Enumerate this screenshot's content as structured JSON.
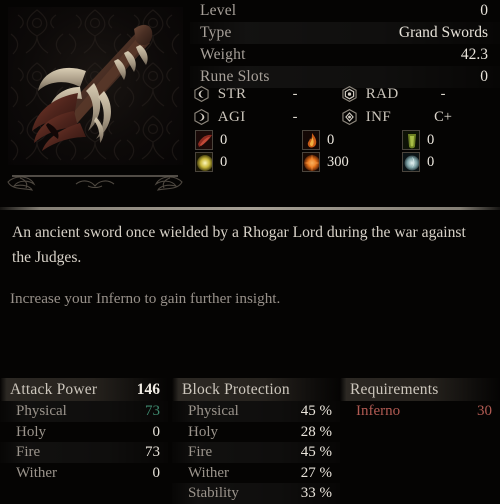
{
  "item": {
    "portrait_name": "weapon-portrait",
    "info_rows": [
      {
        "label": "Level",
        "value": "0"
      },
      {
        "label": "Type",
        "value": "Grand Swords"
      },
      {
        "label": "Weight",
        "value": "42.3"
      },
      {
        "label": "Rune Slots",
        "value": "0"
      }
    ],
    "scaling": [
      {
        "icon": "strength-icon",
        "stat": "STR",
        "grade": "-",
        "icon2": "radiance-icon",
        "stat2": "RAD",
        "grade2": "-"
      },
      {
        "icon": "agility-icon",
        "stat": "AGI",
        "grade": "-",
        "icon2": "inferno-icon",
        "stat2": "INF",
        "grade2": "C+"
      }
    ],
    "damage": [
      {
        "icon": "physical-damage-icon",
        "value": "0",
        "icon_b": "fire-damage-icon",
        "value_b": "0",
        "icon_c": "poison-damage-icon",
        "value_c": "0"
      },
      {
        "icon": "holy-damage-icon",
        "value": "0",
        "icon_b": "burn-damage-icon",
        "value_b": "300",
        "icon_c": "frost-damage-icon",
        "value_c": "0"
      }
    ],
    "description": "An ancient sword once wielded by a Rhogar Lord during the war against the Judges.",
    "hint": "Increase your Inferno to gain further insight."
  },
  "panels": {
    "attack_power": {
      "title": "Attack Power",
      "total": "146",
      "rows": [
        {
          "label": "Physical",
          "value": "73",
          "color": "green"
        },
        {
          "label": "Holy",
          "value": "0",
          "color": ""
        },
        {
          "label": "Fire",
          "value": "73",
          "color": ""
        },
        {
          "label": "Wither",
          "value": "0",
          "color": ""
        }
      ]
    },
    "block_protection": {
      "title": "Block Protection",
      "total": "",
      "rows": [
        {
          "label": "Physical",
          "value": "45 %"
        },
        {
          "label": "Holy",
          "value": "28 %"
        },
        {
          "label": "Fire",
          "value": "45 %"
        },
        {
          "label": "Wither",
          "value": "27 %"
        },
        {
          "label": "Stability",
          "value": "33 %"
        }
      ]
    },
    "requirements": {
      "title": "Requirements",
      "total": "",
      "rows": [
        {
          "label": "Inferno",
          "value": "30",
          "color": "red"
        }
      ]
    }
  },
  "colors": {
    "background": "#050403",
    "text_primary": "#e8e3da",
    "text_muted": "#9b948c",
    "green_value": "#3f8a6f",
    "red_requirement": "#b25b53"
  }
}
